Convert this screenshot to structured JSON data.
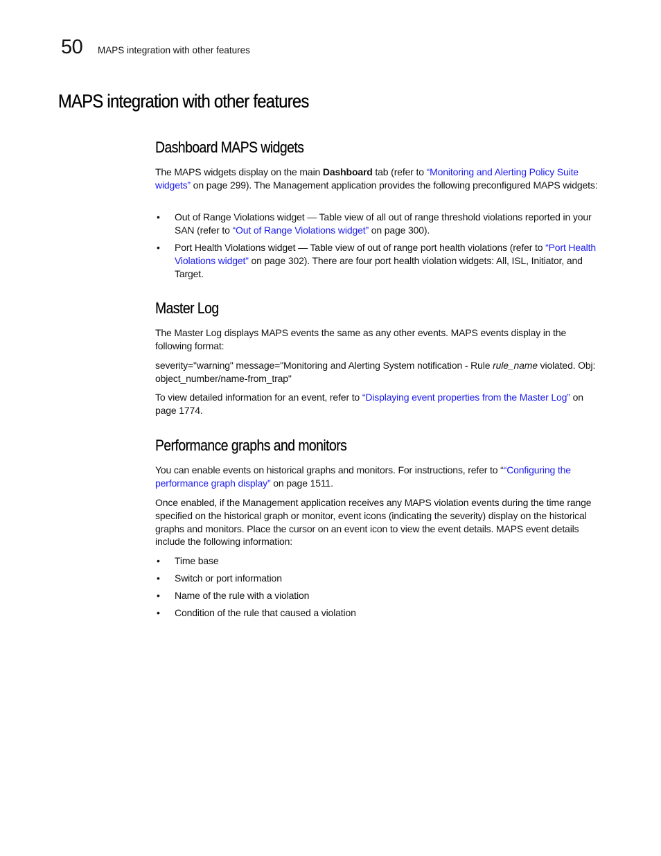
{
  "header": {
    "chapter_number": "50",
    "running_title": "MAPS integration with other features"
  },
  "page_title": "MAPS integration with other features",
  "sections": {
    "dashboard": {
      "heading": "Dashboard MAPS widgets",
      "intro": {
        "t1": "The MAPS widgets display on the main ",
        "bold": "Dashboard",
        "t2": " tab (refer to ",
        "link": "“Monitoring and Alerting Policy Suite widgets”",
        "t3": " on page 299). The Management application provides the following preconfigured MAPS widgets:"
      },
      "bullets": [
        {
          "t1": "Out of Range Violations widget — Table view of all out of range threshold violations reported in your SAN (refer to ",
          "link": "“Out of Range Violations widget”",
          "t2": " on page 300)."
        },
        {
          "t1": "Port Health Violations widget — Table view of out of range port health violations (refer to ",
          "link": "“Port Health Violations widget”",
          "t2": " on page 302). There are four port health violation widgets: All, ISL, Initiator, and Target."
        }
      ]
    },
    "master_log": {
      "heading": "Master Log",
      "p1": "The Master Log displays MAPS events the same as any other events. MAPS events display in the following format:",
      "format": {
        "t1": "severity=\"warning\" message=\"Monitoring and Alerting System notification - Rule ",
        "italic": "rule_name",
        "t2": " violated. Obj: object_number/name-from_trap\""
      },
      "p3": {
        "t1": "To view detailed information for an event, refer to ",
        "link": "“Displaying event properties from the Master Log”",
        "t2": " on page 1774."
      }
    },
    "performance": {
      "heading": "Performance graphs and monitors",
      "p1": {
        "t1": "You can enable events on historical graphs and monitors. For instructions, refer to “",
        "link": "“Configuring the performance graph display”",
        "t2": " on page 1511."
      },
      "p2": "Once enabled, if the Management application receives any MAPS violation events during the time range specified on the historical graph or monitor, event icons (indicating the severity) display on the historical graphs and monitors. Place the cursor on an event icon to view the event details. MAPS event details include the following information:",
      "bullets": [
        "Time base",
        "Switch or port information",
        "Name of the rule with a violation",
        "Condition of the rule that caused a violation"
      ]
    }
  },
  "colors": {
    "link": "#1a1aee",
    "text": "#111111"
  }
}
